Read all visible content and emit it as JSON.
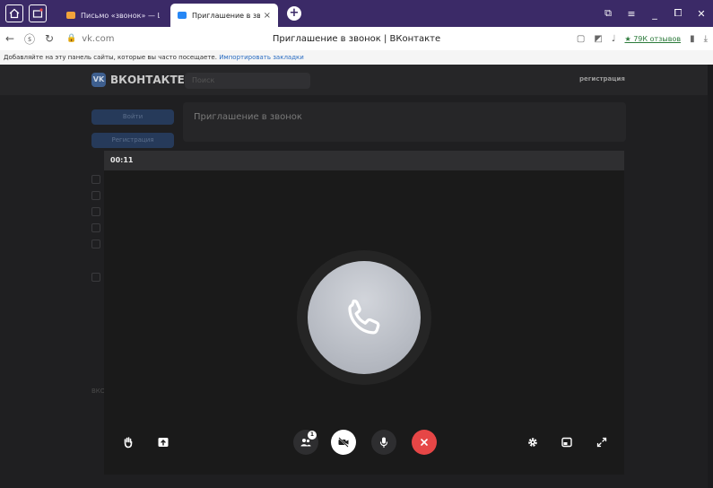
{
  "browser": {
    "tabs": [
      {
        "title": "Письмо «звонок» — ЦРО",
        "favicon_color": "#f2a33a",
        "active": false
      },
      {
        "title": "Приглашение в звонок",
        "favicon_color": "#2787f5",
        "active": true
      }
    ],
    "new_tab_label": "+",
    "close_tab_label": "×",
    "url": "vk.com",
    "page_title": "Приглашение в звонок | ВКонтакте",
    "reviews": "★ 79К отзывов",
    "bookmark_hint": "Добавляйте на эту панель сайты, которые вы часто посещаете.",
    "bookmark_import": "Импортировать закладки",
    "window_controls": [
      "⧉",
      "≡",
      "_",
      "⧠",
      "✕"
    ]
  },
  "vk": {
    "logo_mark": "VK",
    "logo_name": "ВКОНТАКТЕ",
    "search_placeholder": "Поиск",
    "register_link": "регистрация",
    "login_button": "Войти",
    "register_button": "Регистрация",
    "card_title": "Приглашение в звонок",
    "footer_text": "ВКО"
  },
  "call": {
    "timer": "00:11",
    "participants_badge": "1",
    "colors": {
      "end_call": "#e64646",
      "camera_button": "#ffffff"
    },
    "controls": [
      "raise-hand-icon",
      "screen-share-icon",
      "participants-icon",
      "camera-off-icon",
      "microphone-icon",
      "end-call-icon",
      "settings-icon",
      "minimize-window-icon",
      "fullscreen-icon"
    ]
  }
}
